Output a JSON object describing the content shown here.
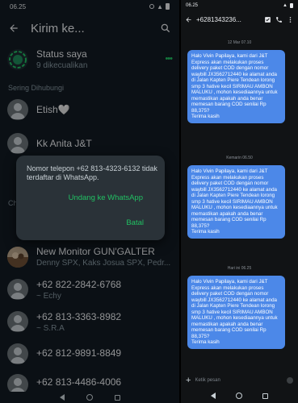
{
  "whatsapp": {
    "status_time": "06.25",
    "title": "Kirim ke...",
    "rows": [
      {
        "name": "Status saya",
        "sub": "9 dikecualikan"
      },
      {
        "name": "Etish🤍",
        "sub": ""
      },
      {
        "name": "Kk Anita J&T",
        "sub": ""
      },
      {
        "name": "New Monitor GUN'GALTER",
        "sub": "Denny SPX, Kaks Josua SPX, Pedr..."
      },
      {
        "name": "+62 822-2842-6768",
        "sub": "~ Echy"
      },
      {
        "name": "+62 813-3363-8982",
        "sub": "~ S.R.A"
      },
      {
        "name": "+62 812-9891-8849",
        "sub": ""
      },
      {
        "name": "+62 813-4486-4006",
        "sub": ""
      }
    ],
    "section_label": "Sering Dihubungi",
    "section_label_2": "Ch",
    "dialog": {
      "message": "Nomor telepon +62 813-4323-6132 tidak terdaftar di WhatsApp.",
      "invite_button": "Undang ke WhatsApp",
      "cancel_button": "Batal"
    }
  },
  "messages": {
    "status_time": "06.25",
    "phone_number": "+6281343236...",
    "threads": [
      {
        "date": "12 Mar 07.10",
        "text": "Halo Vivin Papilaya, kami dari J&T Express akan melakukan proses delivery paket COD dengan nomor waybill JX3562712440 ke alamat anda di Jalan Kapten Piere Tendean  lorong smp 3 hative kecil SIRIMAU AMBON MALUKU , mohon kesediaannya untuk memastikan apakah anda benar memesan barang COD senilai Rp 88,375?\nTerima kasih"
      },
      {
        "date": "Kemarin 06.50",
        "text": "Halo Vivin Papilaya, kami dari J&T Express akan melakukan proses delivery paket COD dengan nomor waybill JX3562712440 ke alamat anda di Jalan Kapten Piere Tendean  lorong smp 3 hative kecil SIRIMAU AMBON MALUKU , mohon kesediaannya untuk memastikan apakah anda benar memesan barang COD senilai Rp 88,375?\nTerima kasih"
      },
      {
        "date": "Hari ini 06.25",
        "text": "Halo Vivin Papilaya, kami dari J&T Express akan melakukan proses delivery paket COD dengan nomor waybill JX3562712440 ke alamat anda di Jalan Kapten Piere Tendean  lorong smp 3 hative kecil SIRIMAU AMBON MALUKU , mohon kesediaannya untuk memastikan apakah anda benar memesan barang COD senilai Rp 88,375?\nTerima kasih"
      }
    ],
    "compose_placeholder": "Ketik pesan"
  },
  "colors": {
    "wa_background": "#121b22",
    "wa_accent": "#21c063",
    "bubble": "#4c88e8",
    "messages_background": "#111315"
  }
}
